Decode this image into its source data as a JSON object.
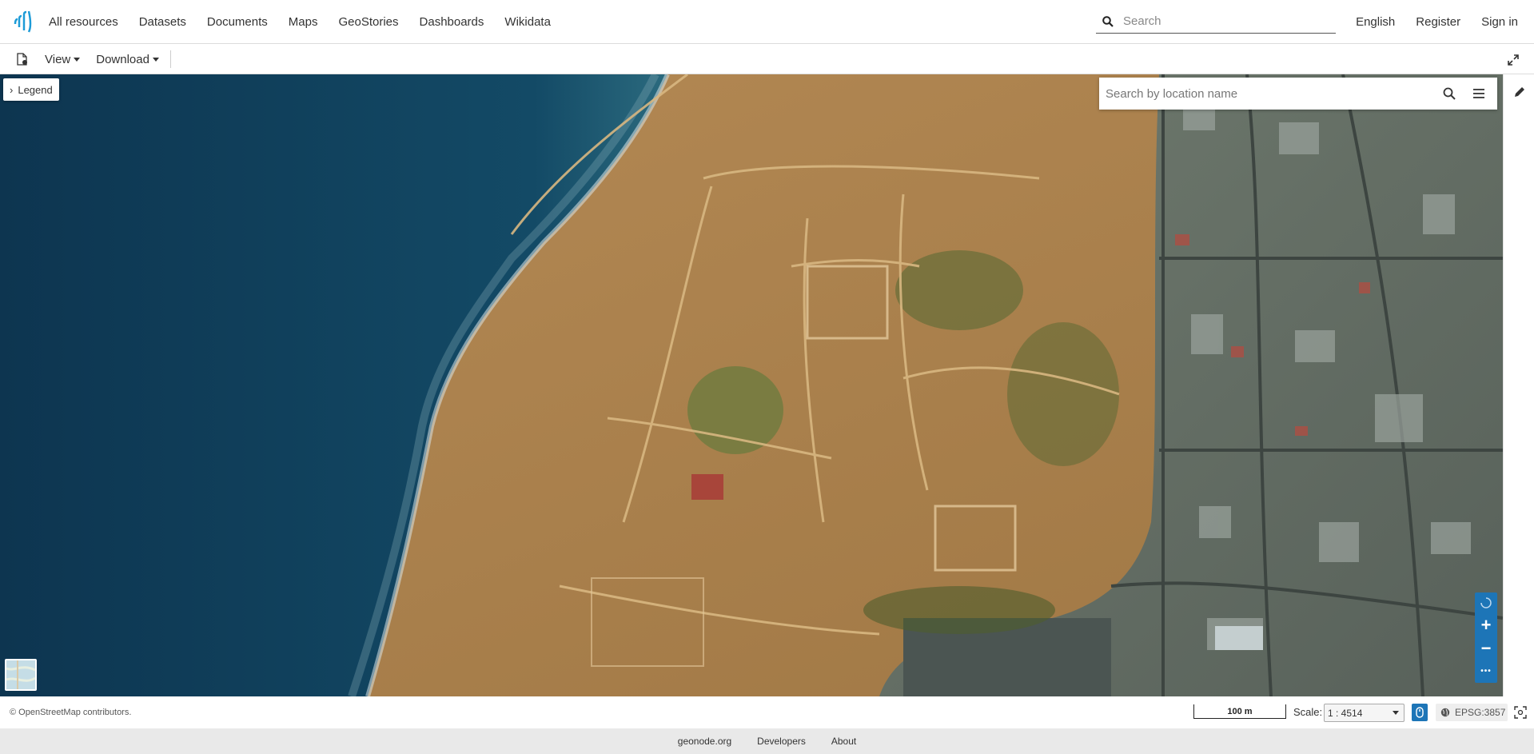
{
  "nav": {
    "links": [
      "All resources",
      "Datasets",
      "Documents",
      "Maps",
      "GeoStories",
      "Dashboards",
      "Wikidata"
    ],
    "search_placeholder": "Search",
    "language": "English",
    "register": "Register",
    "sign_in": "Sign in"
  },
  "toolbar": {
    "view_label": "View",
    "download_label": "Download"
  },
  "map": {
    "legend_label": "Legend",
    "location_search_placeholder": "Search by location name",
    "zoom_in": "+",
    "zoom_out": "−",
    "more": "•••"
  },
  "statusbar": {
    "attribution": "© OpenStreetMap contributors.",
    "scalebar_label": "100 m",
    "scale_label": "Scale:",
    "scale_value": "1 : 4514",
    "crs": "EPSG:3857"
  },
  "footer": {
    "links": [
      "geonode.org",
      "Developers",
      "About"
    ]
  },
  "colors": {
    "accent": "#1d75b7",
    "sea": "#0e3b55",
    "terrain": "#b88a52"
  }
}
